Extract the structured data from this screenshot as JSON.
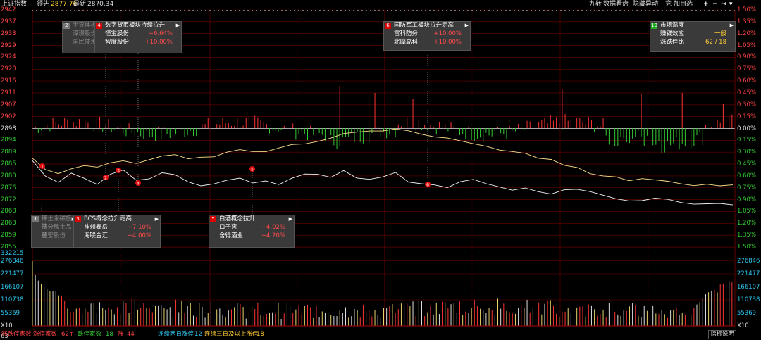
{
  "header": {
    "index_name": "上证指数",
    "lead_label": "领先",
    "lead_value": "2877.76",
    "latest_label": "最新",
    "latest_value": "2870.34",
    "right_items": [
      "九转",
      "数据看盘",
      "隐藏异动",
      "竞",
      "加自选"
    ]
  },
  "price_axis_left": [
    "2942",
    "2937",
    "2933",
    "2929",
    "2924",
    "2920",
    "2916",
    "2911",
    "2907",
    "2902",
    "2898",
    "2894",
    "2889",
    "2885",
    "2880",
    "2876",
    "2872",
    "2868",
    "2863",
    "2859",
    "2855"
  ],
  "pct_axis_right": [
    "1.50%",
    "1.35%",
    "1.20%",
    "1.05%",
    "0.90%",
    "0.75%",
    "0.60%",
    "0.45%",
    "0.30%",
    "0.15%",
    "0.00%",
    "0.15%",
    "0.30%",
    "0.45%",
    "0.60%",
    "0.75%",
    "0.90%",
    "1.05%",
    "1.20%",
    "1.35%",
    "1.50%"
  ],
  "volume_axis_left": [
    "332215",
    "276846",
    "221477",
    "166107",
    "110738",
    "55369",
    "X10"
  ],
  "volume_axis_right": [
    "276846",
    "221477",
    "166107",
    "110738",
    "55369",
    "X10"
  ],
  "bottom_corner": "63",
  "event_boxes": [
    {
      "id": "b2",
      "num": "2",
      "title": "半导体板",
      "rows": [
        {
          "n": "泽璟股份",
          "v": ""
        },
        {
          "n": "国民技术",
          "v": ""
        }
      ],
      "dim": true
    },
    {
      "id": "b4",
      "num": "4",
      "title": "数字货币板块持续拉升",
      "rows": [
        {
          "n": "恒宝股份",
          "v": "+6.64%"
        },
        {
          "n": "智度股份",
          "v": "+10.00%"
        }
      ],
      "dim": false
    },
    {
      "id": "b6",
      "num": "6",
      "title": "国防军工板块拉升走高",
      "rows": [
        {
          "n": "雷科防务",
          "v": "+10.00%"
        },
        {
          "n": "北摩高科",
          "v": "+10.00%"
        }
      ],
      "dim": false
    },
    {
      "id": "b10",
      "num": "10",
      "title": "市场温度",
      "rows": [
        {
          "n": "赚钱效应",
          "v": "一般"
        },
        {
          "n": "涨跌停比",
          "v": "62 / 18"
        }
      ],
      "dim": false
    },
    {
      "id": "b1",
      "num": "1",
      "title": "稀土永磁板块",
      "rows": [
        {
          "n": "部分稀土品种",
          "v": ""
        },
        {
          "n": "德宏股份",
          "v": ""
        }
      ],
      "dim": true
    },
    {
      "id": "b3",
      "num": "3",
      "title": "BCS概念拉升走高",
      "rows": [
        {
          "n": "神州泰岳",
          "v": "+7.10%"
        },
        {
          "n": "海联金汇",
          "v": "+4.00%"
        }
      ],
      "dim": false
    },
    {
      "id": "b5",
      "num": "5",
      "title": "白酒概念拉升",
      "rows": [
        {
          "n": "口子窖",
          "v": "+4.02%"
        },
        {
          "n": "舍得酒业",
          "v": "+4.20%"
        }
      ],
      "dim": false
    }
  ],
  "markers": [
    "1",
    "2",
    "3",
    "4",
    "5",
    "6"
  ],
  "footer": {
    "zt_label": "涨跌停家数",
    "zt_count_label": "涨停家数",
    "zt_count": "62",
    "zt_arrow": "↑",
    "dt_count_label": "跌停家数",
    "dt_count": "18",
    "up_label": "涨",
    "up_count": "44",
    "cont_label": "连续两日涨停",
    "cont_count": "12",
    "cont3_label": "连续三日及以上涨停",
    "cont3_count": "18",
    "help": "指标说明"
  },
  "colors": {
    "up": "#ff3333",
    "down": "#33cc33",
    "price_line": "#f2f2f2",
    "avg_line": "#ffe08a",
    "grid": "#6b0000",
    "axis_left_price": "#ff4444",
    "axis_left_vol": "#2ec7f0"
  }
}
